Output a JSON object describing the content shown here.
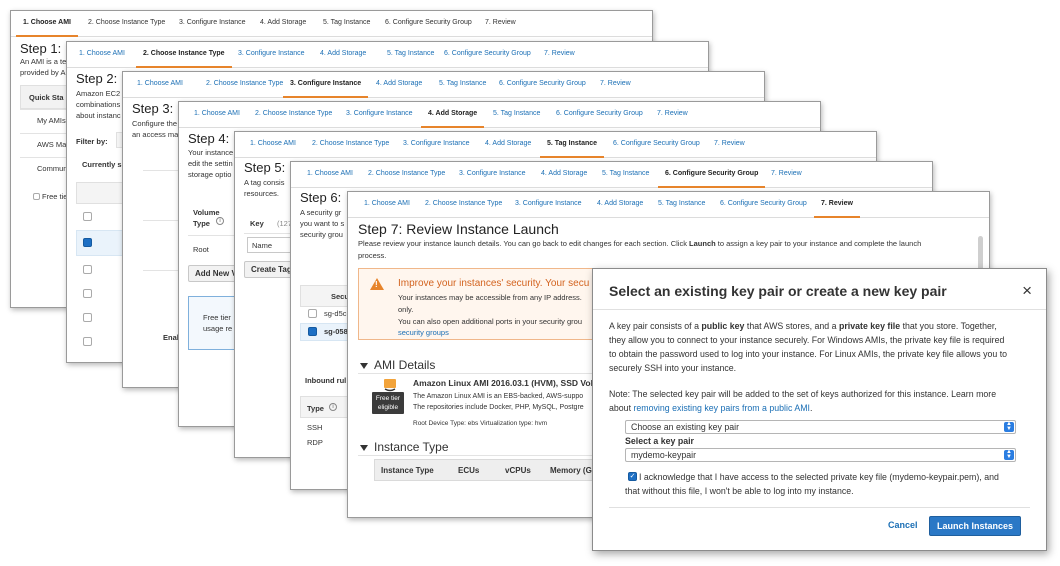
{
  "wizard_tabs": [
    "1. Choose AMI",
    "2. Choose Instance Type",
    "3. Configure Instance",
    "4. Add Storage",
    "5. Tag Instance",
    "6. Configure Security Group",
    "7. Review"
  ],
  "step1": {
    "title": "Step 1:",
    "line1": "An AMI is a te",
    "line2": "provided by A",
    "quick_start": "Quick Sta",
    "my_amis": "My AMIs",
    "aws_marketplace": "AWS Ma",
    "community": "Commun",
    "free_tier": "Free tie"
  },
  "step2": {
    "title": "Step 2:",
    "line1": "Amazon EC2",
    "line2": "combinations",
    "line3": "about instanc",
    "filter_by": "Filter by:",
    "currently": "Currently s"
  },
  "step3": {
    "title": "Step 3:",
    "line1": "Configure the",
    "line2": "an access ma",
    "enable": "Enal"
  },
  "step4": {
    "title": "Step 4:",
    "line1": "Your instance",
    "line2": "edit the settin",
    "line3": "storage optio",
    "volume_type": "Volume Type",
    "root": "Root",
    "add_new": "Add New V",
    "free_tier": "Free tier",
    "usage": "usage re"
  },
  "step5": {
    "title": "Step 5:",
    "line1": "A tag consis",
    "line2": "resources.",
    "key": "Key",
    "key_hint": "(127",
    "name": "Name",
    "create_tag": "Create Tag"
  },
  "step6": {
    "title": "Step 6:",
    "line1": "A security gr",
    "line2": "you want to s",
    "line3": "security grou",
    "secu": "Secu",
    "sg1": "sg-d5c",
    "sg2": "sg-058",
    "inbound": "Inbound rul",
    "type": "Type",
    "ssh": "SSH",
    "rdp": "RDP"
  },
  "step7": {
    "title": "Step 7: Review Instance Launch",
    "intro_a": "Please review your instance launch details. You can go back to edit changes for each section. Click ",
    "intro_launch": "Launch",
    "intro_b": " to assign a key pair to your instance and complete the launch",
    "intro_c": "process.",
    "warn_title": "Improve your instances' security. Your secu",
    "warn_l1": "Your instances may be accessible from any IP address.",
    "warn_l2": "only.",
    "warn_l3": "You can also open additional ports in your security grou",
    "warn_link": "security groups",
    "ami_details": "AMI Details",
    "ami_name": "Amazon Linux AMI 2016.03.1 (HVM), SSD Vol",
    "ami_d1": "The Amazon Linux AMI is an EBS-backed, AWS-suppo",
    "ami_d2": "The repositories include Docker, PHP, MySQL, Postgre",
    "ami_d3": "Root Device Type: ebs     Virtualization type: hvm",
    "free_badge": "Free tier eligible",
    "instance_type": "Instance Type",
    "cols": [
      "Instance Type",
      "ECUs",
      "vCPUs",
      "Memory (G"
    ]
  },
  "modal": {
    "title": "Select an existing key pair or create a new key pair",
    "close": "×",
    "p1_l1_a": "A key pair consists of a ",
    "p1_l1_b": "public key",
    "p1_l1_c": " that AWS stores, and a ",
    "p1_l1_d": "private key file",
    "p1_l1_e": " that you store. Together,",
    "p1_l2": "they allow you to connect to your instance securely. For Windows AMIs, the private key file is required",
    "p1_l3": "to obtain the password used to log into your instance. For Linux AMIs, the private key file allows you to",
    "p1_l4": "securely SSH into your instance.",
    "note_l1": "Note: The selected key pair will be added to the set of keys authorized for this instance. Learn more",
    "note_l2_a": "about ",
    "note_link": "removing existing key pairs from a public AMI",
    "note_l2_b": ".",
    "select1_value": "Choose an existing key pair",
    "select_label": "Select a key pair",
    "select2_value": "mydemo-keypair",
    "ack_l1": "I acknowledge that I have access to the selected private key file (mydemo-keypair.pem), and",
    "ack_l2": "that without this file, I won't be able to log into my instance.",
    "cancel": "Cancel",
    "launch": "Launch Instances"
  }
}
